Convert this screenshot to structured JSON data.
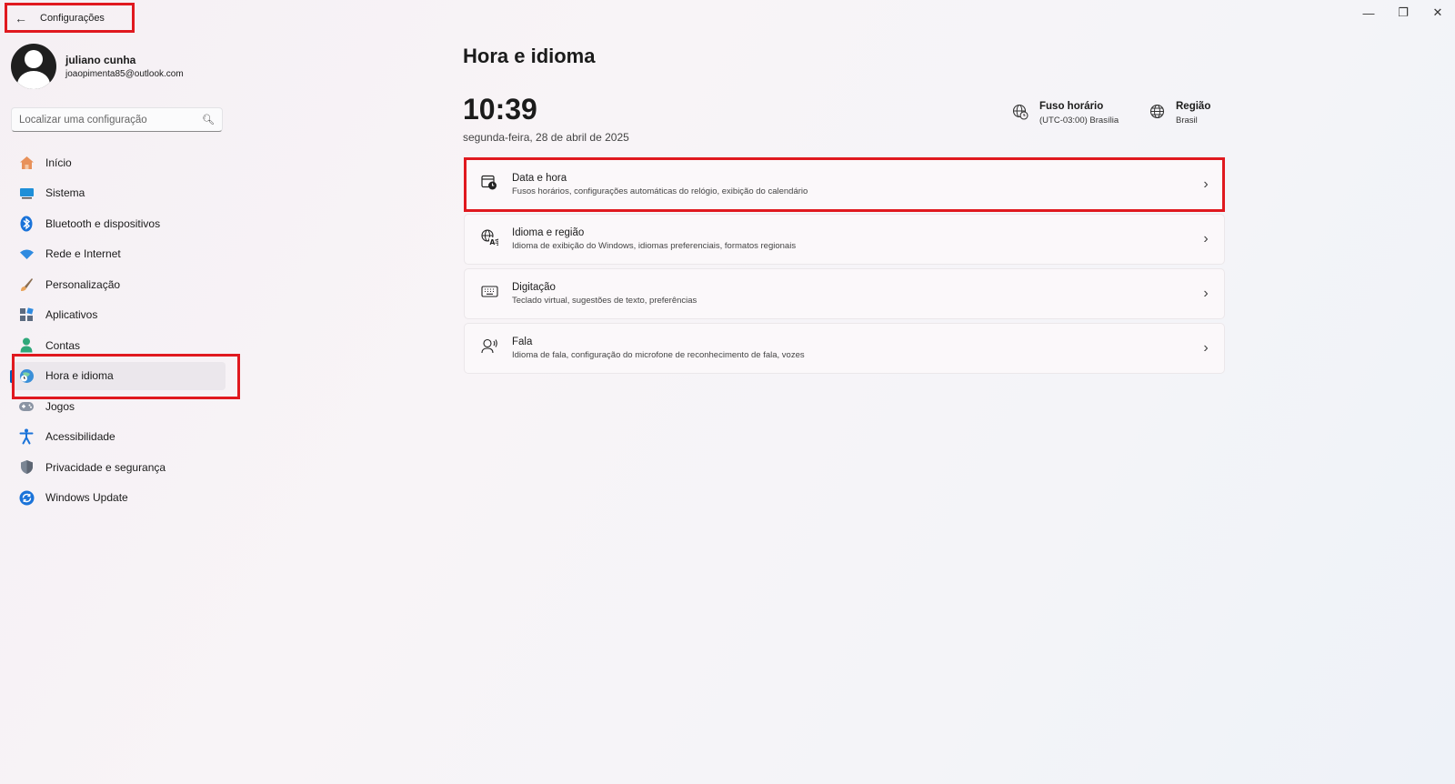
{
  "window": {
    "back_icon": "back-arrow-icon",
    "title": "Configurações",
    "controls": {
      "minimize": "—",
      "restore": "❐",
      "close": "✕"
    }
  },
  "profile": {
    "name": "juliano cunha",
    "email": "joaopimenta85@outlook.com"
  },
  "search": {
    "placeholder": "Localizar uma configuração",
    "value": ""
  },
  "sidebar": {
    "items": [
      {
        "label": "Início",
        "icon": "home-icon"
      },
      {
        "label": "Sistema",
        "icon": "monitor-icon"
      },
      {
        "label": "Bluetooth e dispositivos",
        "icon": "bluetooth-icon"
      },
      {
        "label": "Rede e Internet",
        "icon": "wifi-icon"
      },
      {
        "label": "Personalização",
        "icon": "brush-icon"
      },
      {
        "label": "Aplicativos",
        "icon": "apps-icon"
      },
      {
        "label": "Contas",
        "icon": "person-icon"
      },
      {
        "label": "Hora e idioma",
        "icon": "globe-clock-icon",
        "active": true
      },
      {
        "label": "Jogos",
        "icon": "gamepad-icon"
      },
      {
        "label": "Acessibilidade",
        "icon": "accessibility-icon"
      },
      {
        "label": "Privacidade e segurança",
        "icon": "shield-icon"
      },
      {
        "label": "Windows Update",
        "icon": "update-icon"
      }
    ]
  },
  "main": {
    "title": "Hora e idioma",
    "time": "10:39",
    "date": "segunda-feira, 28 de abril de 2025",
    "timezone": {
      "label": "Fuso horário",
      "value": "(UTC-03:00) Brasília"
    },
    "region": {
      "label": "Região",
      "value": "Brasil"
    },
    "cards": [
      {
        "title": "Data e hora",
        "desc": "Fusos horários, configurações automáticas do relógio, exibição do calendário",
        "icon": "calendar-clock-icon"
      },
      {
        "title": "Idioma e região",
        "desc": "Idioma de exibição do Windows, idiomas preferenciais, formatos regionais",
        "icon": "language-icon"
      },
      {
        "title": "Digitação",
        "desc": "Teclado virtual, sugestões de texto, preferências",
        "icon": "keyboard-icon"
      },
      {
        "title": "Fala",
        "desc": "Idioma de fala, configuração do microfone de reconhecimento de fala, vozes",
        "icon": "speech-icon"
      }
    ]
  },
  "colors": {
    "accent": "#005fb8",
    "highlight": "#e0191f"
  }
}
